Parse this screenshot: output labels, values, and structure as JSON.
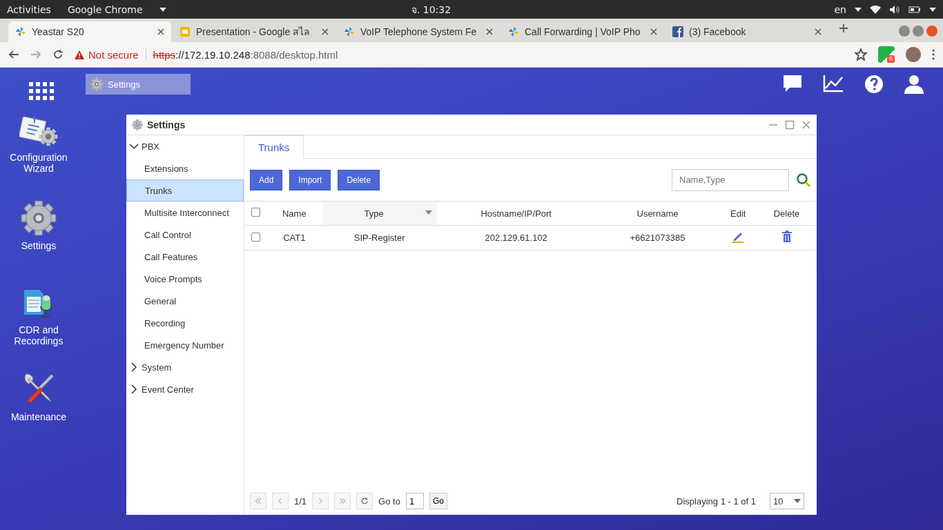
{
  "top_bar": {
    "activities": "Activities",
    "app": "Google Chrome",
    "clock": "จ. 10:32",
    "language": "en"
  },
  "browser": {
    "tabs": [
      {
        "title": "Yeastar S20",
        "selected": true,
        "kind": "yeastar"
      },
      {
        "title": "Presentation - Google สไล",
        "selected": false,
        "kind": "slides"
      },
      {
        "title": "VoIP Telephone System Fe",
        "selected": false,
        "kind": "yeastar"
      },
      {
        "title": "Call Forwarding | VoIP Pho",
        "selected": false,
        "kind": "yeastar"
      },
      {
        "title": "(3) Facebook",
        "selected": false,
        "kind": "facebook"
      }
    ],
    "address": {
      "security": "Not secure",
      "scheme": "https",
      "host": "://172.19.10.248",
      "path": ":8088/desktop.html"
    },
    "extension_badge": "6"
  },
  "desktop": {
    "taskbar_window": "Settings",
    "icons": [
      {
        "label": "Configuration Wizard",
        "kind": "wizard"
      },
      {
        "label": "Settings",
        "kind": "settings"
      },
      {
        "label": "CDR and Recordings",
        "kind": "cdr"
      },
      {
        "label": "Maintenance",
        "kind": "maintenance"
      }
    ]
  },
  "window": {
    "title": "Settings",
    "nav": [
      {
        "label": "PBX",
        "expanded": true,
        "children": [
          {
            "label": "Extensions",
            "selected": false
          },
          {
            "label": "Trunks",
            "selected": true
          },
          {
            "label": "Multisite Interconnect",
            "selected": false
          },
          {
            "label": "Call Control",
            "selected": false
          },
          {
            "label": "Call Features",
            "selected": false
          },
          {
            "label": "Voice Prompts",
            "selected": false
          },
          {
            "label": "General",
            "selected": false
          },
          {
            "label": "Recording",
            "selected": false
          },
          {
            "label": "Emergency Number",
            "selected": false
          }
        ]
      },
      {
        "label": "System",
        "expanded": false
      },
      {
        "label": "Event Center",
        "expanded": false
      }
    ],
    "tabs": [
      {
        "label": "Trunks",
        "selected": true
      }
    ],
    "buttons": [
      "Add",
      "Import",
      "Delete"
    ],
    "search": {
      "placeholder": "Name,Type"
    },
    "table": {
      "header_checked": false,
      "columns": [
        "Name",
        "Type",
        "Hostname/IP/Port",
        "Username",
        "Edit",
        "Delete"
      ],
      "rows": [
        {
          "checked": false,
          "cells": [
            "CAT1",
            "SIP-Register",
            "202.129.61.102",
            "+6621073385"
          ]
        }
      ]
    },
    "pagination": {
      "page": "1/1",
      "goto_label": "Go to",
      "goto_value": "1",
      "go": "Go",
      "summary": "Displaying 1 - 1 of 1",
      "page_size": "10"
    }
  }
}
